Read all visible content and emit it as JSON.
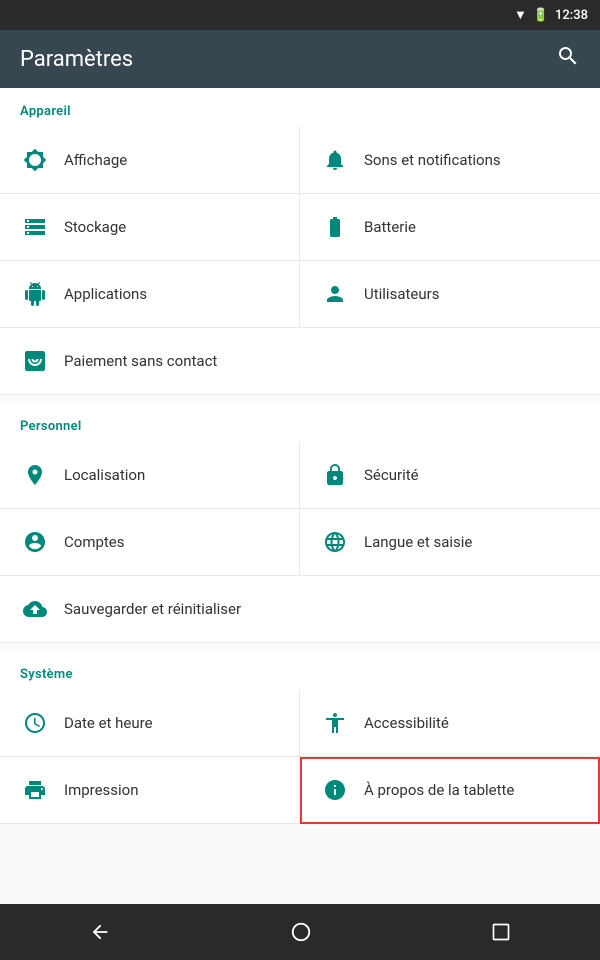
{
  "statusBar": {
    "time": "12:38"
  },
  "topBar": {
    "title": "Paramètres",
    "searchLabel": "search"
  },
  "sections": [
    {
      "id": "appareil",
      "label": "Appareil",
      "items": [
        {
          "id": "affichage",
          "label": "Affichage",
          "icon": "brightness",
          "fullWidth": false
        },
        {
          "id": "sons",
          "label": "Sons et notifications",
          "icon": "bell",
          "fullWidth": false
        },
        {
          "id": "stockage",
          "label": "Stockage",
          "icon": "storage",
          "fullWidth": false
        },
        {
          "id": "batterie",
          "label": "Batterie",
          "icon": "battery",
          "fullWidth": false
        },
        {
          "id": "applications",
          "label": "Applications",
          "icon": "android",
          "fullWidth": false
        },
        {
          "id": "utilisateurs",
          "label": "Utilisateurs",
          "icon": "person",
          "fullWidth": false
        },
        {
          "id": "paiement",
          "label": "Paiement sans contact",
          "icon": "nfc",
          "fullWidth": true
        }
      ]
    },
    {
      "id": "personnel",
      "label": "Personnel",
      "items": [
        {
          "id": "localisation",
          "label": "Localisation",
          "icon": "location",
          "fullWidth": false
        },
        {
          "id": "securite",
          "label": "Sécurité",
          "icon": "lock",
          "fullWidth": false
        },
        {
          "id": "comptes",
          "label": "Comptes",
          "icon": "account",
          "fullWidth": false
        },
        {
          "id": "langue",
          "label": "Langue et saisie",
          "icon": "globe",
          "fullWidth": false
        },
        {
          "id": "sauvegarder",
          "label": "Sauvegarder et réinitialiser",
          "icon": "backup",
          "fullWidth": true
        }
      ]
    },
    {
      "id": "systeme",
      "label": "Système",
      "items": [
        {
          "id": "date",
          "label": "Date et heure",
          "icon": "clock",
          "fullWidth": false
        },
        {
          "id": "accessibilite",
          "label": "Accessibilité",
          "icon": "accessibility",
          "fullWidth": false
        },
        {
          "id": "impression",
          "label": "Impression",
          "icon": "print",
          "fullWidth": false
        },
        {
          "id": "apropos",
          "label": "À propos de la tablette",
          "icon": "info",
          "fullWidth": false,
          "highlighted": true
        }
      ]
    }
  ],
  "navBar": {
    "back": "◁",
    "home": "○",
    "recent": "□"
  }
}
